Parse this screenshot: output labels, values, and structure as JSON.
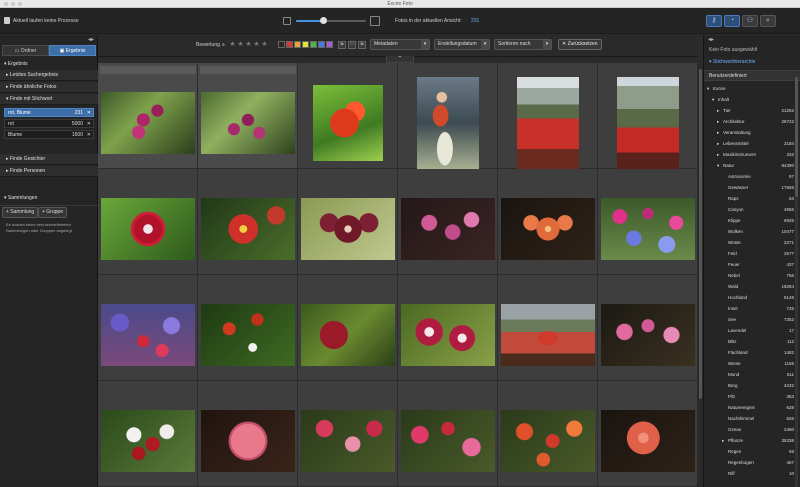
{
  "window": {
    "title": "Excire Foto"
  },
  "toolbar": {
    "status_text": "Aktuell laufen keine Prozesse",
    "photos_label": "Fotos in der aktuellen Ansicht:",
    "photos_count": "231",
    "zoom_fraction": 0.38
  },
  "left": {
    "tabs": [
      {
        "label": "Ordner",
        "active": false
      },
      {
        "label": "Ergebnis",
        "active": true
      }
    ],
    "sections": {
      "ergebnis": "Ergebnis",
      "letztes": "Letztes Suchergebnis",
      "aehnliche": "Finde ähnliche Fotos",
      "stichwort": "Finde mit Stichwort",
      "gesichter": "Finde Gesichter",
      "personen": "Finde Personen",
      "sammlungen": "Sammlungen"
    },
    "keywords": [
      {
        "name": "rot, Blume",
        "count": "231",
        "x": "✕",
        "selected": true
      },
      {
        "name": "rot",
        "count": "5000",
        "x": "✕",
        "selected": false
      },
      {
        "name": "Blume",
        "count": "1500",
        "x": "✕",
        "selected": false
      }
    ],
    "add_collection": "+ Sammlung",
    "add_group": "+ Gruppe",
    "no_collections_note": "Es wurden keine benutzerdefinierten Sammlungen oder Gruppen angelegt."
  },
  "filter": {
    "rating_label": "Bewertung",
    "rating_op": "≥",
    "stars": [
      "★",
      "★",
      "★",
      "★",
      "★"
    ],
    "swatches": [
      "#2a2a2a",
      "#d23a3a",
      "#e8a33a",
      "#e8e23a",
      "#4cb84c",
      "#4a7ae0",
      "#a85ad8"
    ],
    "flags": [
      "⚑",
      "⚐",
      "⚑"
    ],
    "metadata": "Metadaten",
    "date": "Erstellungsdatum",
    "sort": "Sortieren nach",
    "reset": "✕ Zurücksetzen",
    "caret": "▾",
    "collapse": "⌃"
  },
  "grid": {
    "photos": [
      [
        "orchid-magenta",
        "orchid-magenta-2",
        "red-poppy",
        "woman-desk",
        "red-field-landscape",
        "red-field-landscape-2"
      ],
      [
        "red-anemone",
        "red-dahlia-spiky",
        "maroon-orchid",
        "pink-orchids",
        "orange-orchid",
        "pink-blue-flowerbed"
      ],
      [
        "purple-red-flowerbed",
        "red-roses-leaves",
        "red-rosebud",
        "white-lilies",
        "red-chair-landscape",
        "pink-orchids-2"
      ],
      [
        "white-red-rose-bouquet",
        "pink-rose-ball",
        "pink-dahlias",
        "red-pink-dahlias",
        "orange-red-dahlias",
        "coral-dahlia"
      ]
    ]
  },
  "right": {
    "no_photo": "Kein Foto ausgewählt",
    "hierarchy": "Stichworthierarchie",
    "custom": "Benutzerdefiniert",
    "rows": [
      {
        "name": "Excire",
        "count": "",
        "level": 0,
        "arrow": "▾"
      },
      {
        "name": "Inhalt",
        "count": "",
        "level": 1,
        "arrow": "▾"
      },
      {
        "name": "Tier",
        "count": "21252",
        "level": 2,
        "arrow": "▸"
      },
      {
        "name": "Architektur",
        "count": "26722",
        "level": 2,
        "arrow": "▸"
      },
      {
        "name": "Veranstaltung",
        "count": "",
        "level": 2,
        "arrow": "▸"
      },
      {
        "name": "Lebensmittel",
        "count": "2184",
        "level": 2,
        "arrow": "▸"
      },
      {
        "name": "Musikinstrument",
        "count": "332",
        "level": 2,
        "arrow": "▸"
      },
      {
        "name": "Natur",
        "count": "84390",
        "level": 2,
        "arrow": "▾"
      },
      {
        "name": "Astronomie",
        "count": "97",
        "level": 3,
        "arrow": ""
      },
      {
        "name": "Gewässer",
        "count": "17665",
        "level": 3,
        "arrow": ""
      },
      {
        "name": "Raps",
        "count": "63",
        "level": 3,
        "arrow": ""
      },
      {
        "name": "Canyon",
        "count": "4956",
        "level": 3,
        "arrow": ""
      },
      {
        "name": "Klippe",
        "count": "6925",
        "level": 3,
        "arrow": ""
      },
      {
        "name": "Wolken",
        "count": "10477",
        "level": 3,
        "arrow": ""
      },
      {
        "name": "Wüste",
        "count": "2271",
        "level": 3,
        "arrow": ""
      },
      {
        "name": "Feld",
        "count": "2577",
        "level": 3,
        "arrow": ""
      },
      {
        "name": "Feuer",
        "count": "437",
        "level": 3,
        "arrow": ""
      },
      {
        "name": "Nebel",
        "count": "756",
        "level": 3,
        "arrow": ""
      },
      {
        "name": "Wald",
        "count": "19284",
        "level": 3,
        "arrow": ""
      },
      {
        "name": "Hochland",
        "count": "6149",
        "level": 3,
        "arrow": ""
      },
      {
        "name": "Insel",
        "count": "725",
        "level": 3,
        "arrow": ""
      },
      {
        "name": "See",
        "count": "7352",
        "level": 3,
        "arrow": ""
      },
      {
        "name": "Lavendel",
        "count": "17",
        "level": 3,
        "arrow": ""
      },
      {
        "name": "Blitz",
        "count": "112",
        "level": 3,
        "arrow": ""
      },
      {
        "name": "Flachland",
        "count": "1482",
        "level": 3,
        "arrow": ""
      },
      {
        "name": "Wiese",
        "count": "1165",
        "level": 3,
        "arrow": ""
      },
      {
        "name": "Mond",
        "count": "511",
        "level": 3,
        "arrow": ""
      },
      {
        "name": "Berg",
        "count": "4232",
        "level": 3,
        "arrow": ""
      },
      {
        "name": "Pilz",
        "count": "363",
        "level": 3,
        "arrow": ""
      },
      {
        "name": "Naturereignis",
        "count": "628",
        "level": 3,
        "arrow": ""
      },
      {
        "name": "Nachthimmel",
        "count": "626",
        "level": 3,
        "arrow": ""
      },
      {
        "name": "Ozean",
        "count": "2460",
        "level": 3,
        "arrow": ""
      },
      {
        "name": "Pflanze",
        "count": "35338",
        "level": 3,
        "arrow": "▸"
      },
      {
        "name": "Regen",
        "count": "69",
        "level": 3,
        "arrow": ""
      },
      {
        "name": "Regenbogen",
        "count": "467",
        "level": 3,
        "arrow": ""
      },
      {
        "name": "Riff",
        "count": "10",
        "level": 3,
        "arrow": ""
      }
    ]
  }
}
